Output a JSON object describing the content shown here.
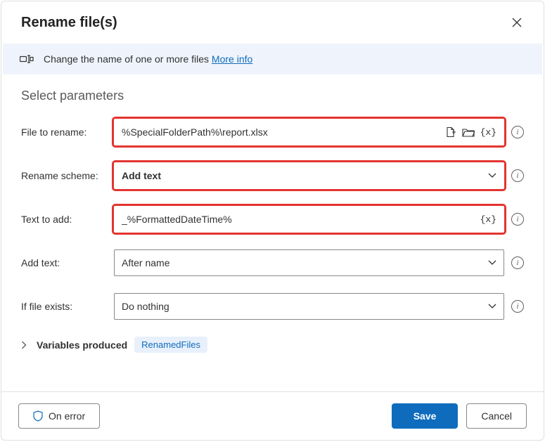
{
  "header": {
    "title": "Rename file(s)"
  },
  "banner": {
    "text": "Change the name of one or more files ",
    "link": "More info"
  },
  "section": {
    "title": "Select parameters"
  },
  "fields": {
    "file_to_rename": {
      "label": "File to rename:",
      "value": "%SpecialFolderPath%\\report.xlsx"
    },
    "rename_scheme": {
      "label": "Rename scheme:",
      "value": "Add text"
    },
    "text_to_add": {
      "label": "Text to add:",
      "value": "_%FormattedDateTime%"
    },
    "add_text": {
      "label": "Add text:",
      "value": "After name"
    },
    "if_exists": {
      "label": "If file exists:",
      "value": "Do nothing"
    }
  },
  "variables": {
    "label": "Variables produced",
    "chip": "RenamedFiles"
  },
  "footer": {
    "on_error": "On error",
    "save": "Save",
    "cancel": "Cancel"
  }
}
